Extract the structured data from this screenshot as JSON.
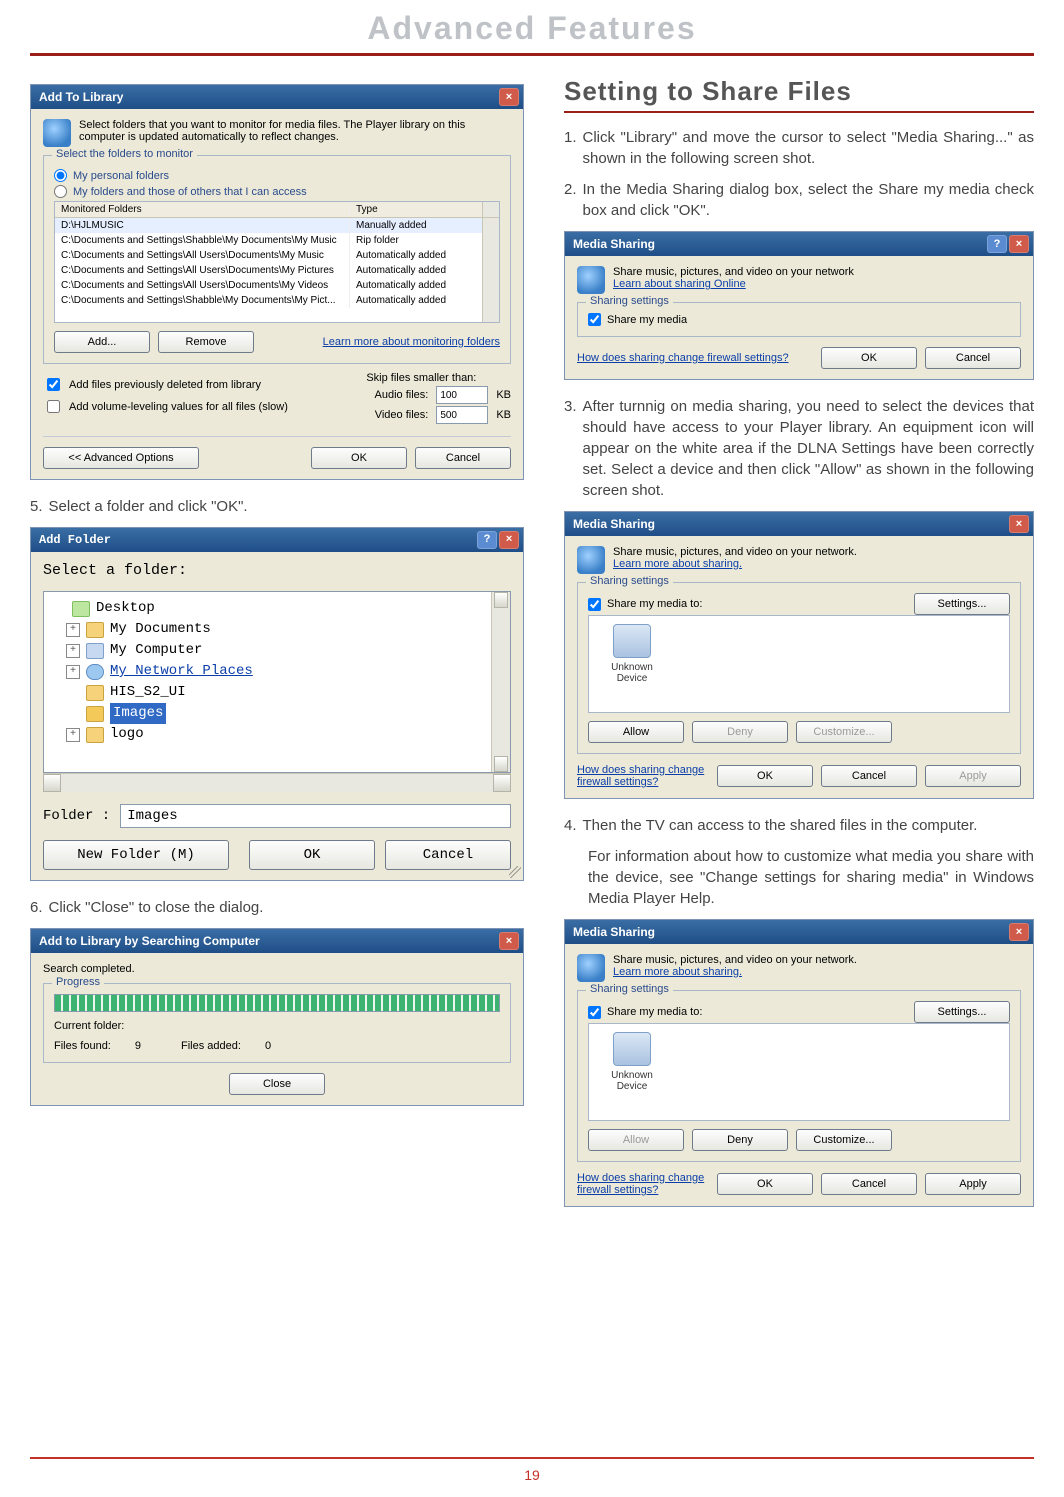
{
  "document": {
    "header_title": "Advanced Features",
    "page_number": "19"
  },
  "left_steps": {
    "step5": "Select a folder and click \"OK\".",
    "step6": "Click \"Close\" to close the dialog."
  },
  "right": {
    "section_title": "Setting to Share Files",
    "step1": "Click \"Library\" and move the cursor to select \"Media Sharing...\" as shown in the following screen shot.",
    "step2": "In the Media Sharing dialog box, select the Share my media check box and click \"OK\".",
    "step3": "After turnnig on media sharing, you need to select the devices that should have access to your Player library. An equipment icon will appear on the white area if the DLNA Settings have been correctly set. Select a device and then click \"Allow\" as shown in the following screen shot.",
    "step4": "Then the TV can access to the shared files in the computer.",
    "note": "For information about how to customize what media you share with the device, see \"Change settings for sharing media\" in Windows Media Player Help."
  },
  "atl": {
    "title": "Add To Library",
    "intro": "Select folders that you want to monitor for media files. The Player library on this computer is updated automatically to reflect changes.",
    "group_label": "Select the folders to monitor",
    "radio1": "My personal folders",
    "radio2": "My folders and those of others that I can access",
    "col_folders": "Monitored Folders",
    "col_type": "Type",
    "rows": [
      {
        "path": "D:\\HJLMUSIC",
        "type": "Manually added"
      },
      {
        "path": "C:\\Documents and Settings\\Shabble\\My Documents\\My Music",
        "type": "Rip folder"
      },
      {
        "path": "C:\\Documents and Settings\\All Users\\Documents\\My Music",
        "type": "Automatically added"
      },
      {
        "path": "C:\\Documents and Settings\\All Users\\Documents\\My Pictures",
        "type": "Automatically added"
      },
      {
        "path": "C:\\Documents and Settings\\All Users\\Documents\\My Videos",
        "type": "Automatically added"
      },
      {
        "path": "C:\\Documents and Settings\\Shabble\\My Documents\\My Pict...",
        "type": "Automatically added"
      }
    ],
    "btn_add": "Add...",
    "btn_remove": "Remove",
    "learn_more": "Learn more about monitoring folders",
    "chk_prev_deleted": "Add files previously deleted from library",
    "chk_volume": "Add volume-leveling values for all files (slow)",
    "skip_label": "Skip files smaller than:",
    "audio_label": "Audio files:",
    "audio_val": "100",
    "video_label": "Video files:",
    "video_val": "500",
    "kb": "KB",
    "btn_adv": "<< Advanced Options",
    "btn_ok": "OK",
    "btn_cancel": "Cancel"
  },
  "addfolder": {
    "title": "Add Folder",
    "prompt": "Select a folder:",
    "tree": {
      "desktop": "Desktop",
      "mydocs": "My Documents",
      "mycomp": "My Computer",
      "netplaces": "My Network Places",
      "his": "HIS_S2_UI",
      "images": "Images",
      "logo": "logo"
    },
    "field_label": "Folder :",
    "field_value": "Images",
    "btn_new": "New Folder (M)",
    "btn_ok": "OK",
    "btn_cancel": "Cancel"
  },
  "search": {
    "title": "Add to Library by Searching Computer",
    "status": "Search completed.",
    "group_label": "Progress",
    "current_folder_label": "Current folder:",
    "files_found_label": "Files found:",
    "files_found_value": "9",
    "files_added_label": "Files added:",
    "files_added_value": "0",
    "btn_close": "Close"
  },
  "ms1": {
    "title": "Media Sharing",
    "intro": "Share music, pictures, and video on your network",
    "learn": "Learn about sharing Online",
    "group_label": "Sharing settings",
    "chk_label": "Share my media",
    "firewall": "How does sharing change firewall settings?",
    "btn_ok": "OK",
    "btn_cancel": "Cancel"
  },
  "ms2": {
    "title": "Media Sharing",
    "intro": "Share music, pictures, and video on your network.",
    "learn": "Learn more about sharing.",
    "group_label": "Sharing settings",
    "chk_label": "Share my media to:",
    "btn_settings": "Settings...",
    "device_label": "Unknown Device",
    "btn_allow": "Allow",
    "btn_deny": "Deny",
    "btn_customize": "Customize...",
    "firewall": "How does sharing change firewall settings?",
    "btn_ok": "OK",
    "btn_cancel": "Cancel",
    "btn_apply": "Apply"
  },
  "ms3": {
    "title": "Media Sharing",
    "intro": "Share music, pictures, and video on your network.",
    "learn": "Learn more about sharing.",
    "group_label": "Sharing settings",
    "chk_label": "Share my media to:",
    "btn_settings": "Settings...",
    "device_label": "Unknown Device",
    "btn_allow": "Allow",
    "btn_deny": "Deny",
    "btn_customize": "Customize...",
    "firewall": "How does sharing change firewall settings?",
    "btn_ok": "OK",
    "btn_cancel": "Cancel",
    "btn_apply": "Apply"
  }
}
